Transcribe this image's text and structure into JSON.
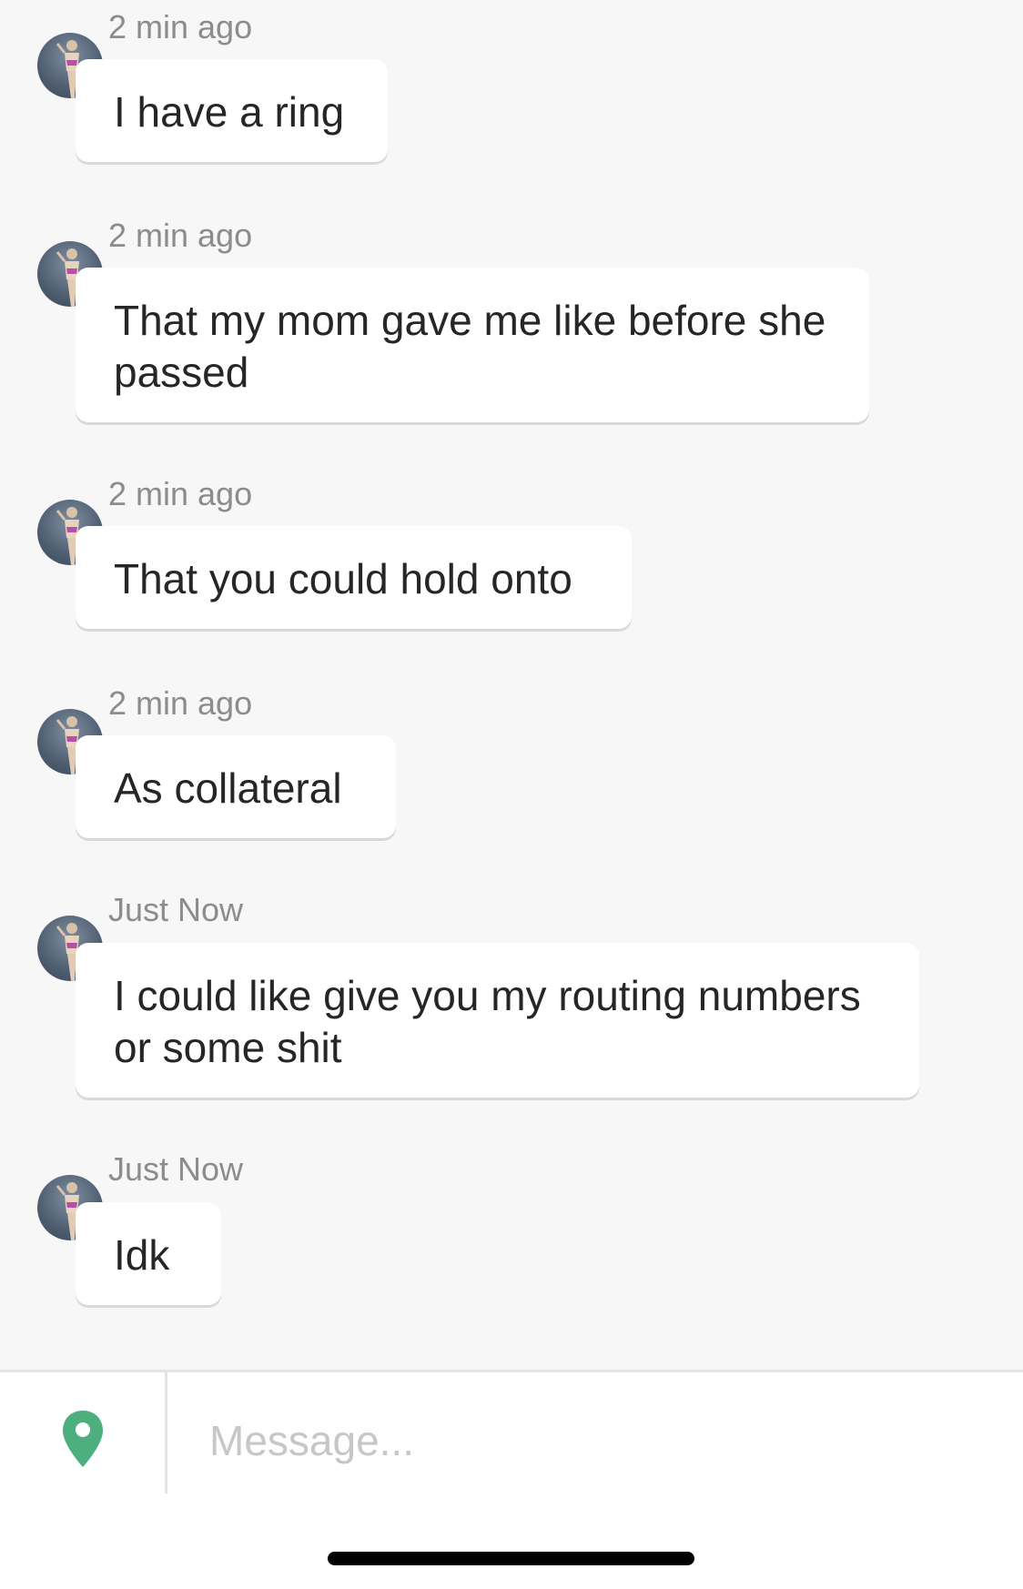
{
  "messages": [
    {
      "time": "2 min ago",
      "text": "I have a ring"
    },
    {
      "time": "2 min ago",
      "text": "That my mom gave me like before she passed"
    },
    {
      "time": "2 min ago",
      "text": "That you could hold onto"
    },
    {
      "time": "2 min ago",
      "text": "As collateral"
    },
    {
      "time": "Just Now",
      "text": "I could like give you my routing numbers or some shit"
    },
    {
      "time": "Just Now",
      "text": "Idk"
    }
  ],
  "composer": {
    "placeholder": "Message...",
    "value": "",
    "location_icon": "map-pin-icon",
    "accent_color": "#4caf7d"
  },
  "avatar_icon": "profile-photo"
}
